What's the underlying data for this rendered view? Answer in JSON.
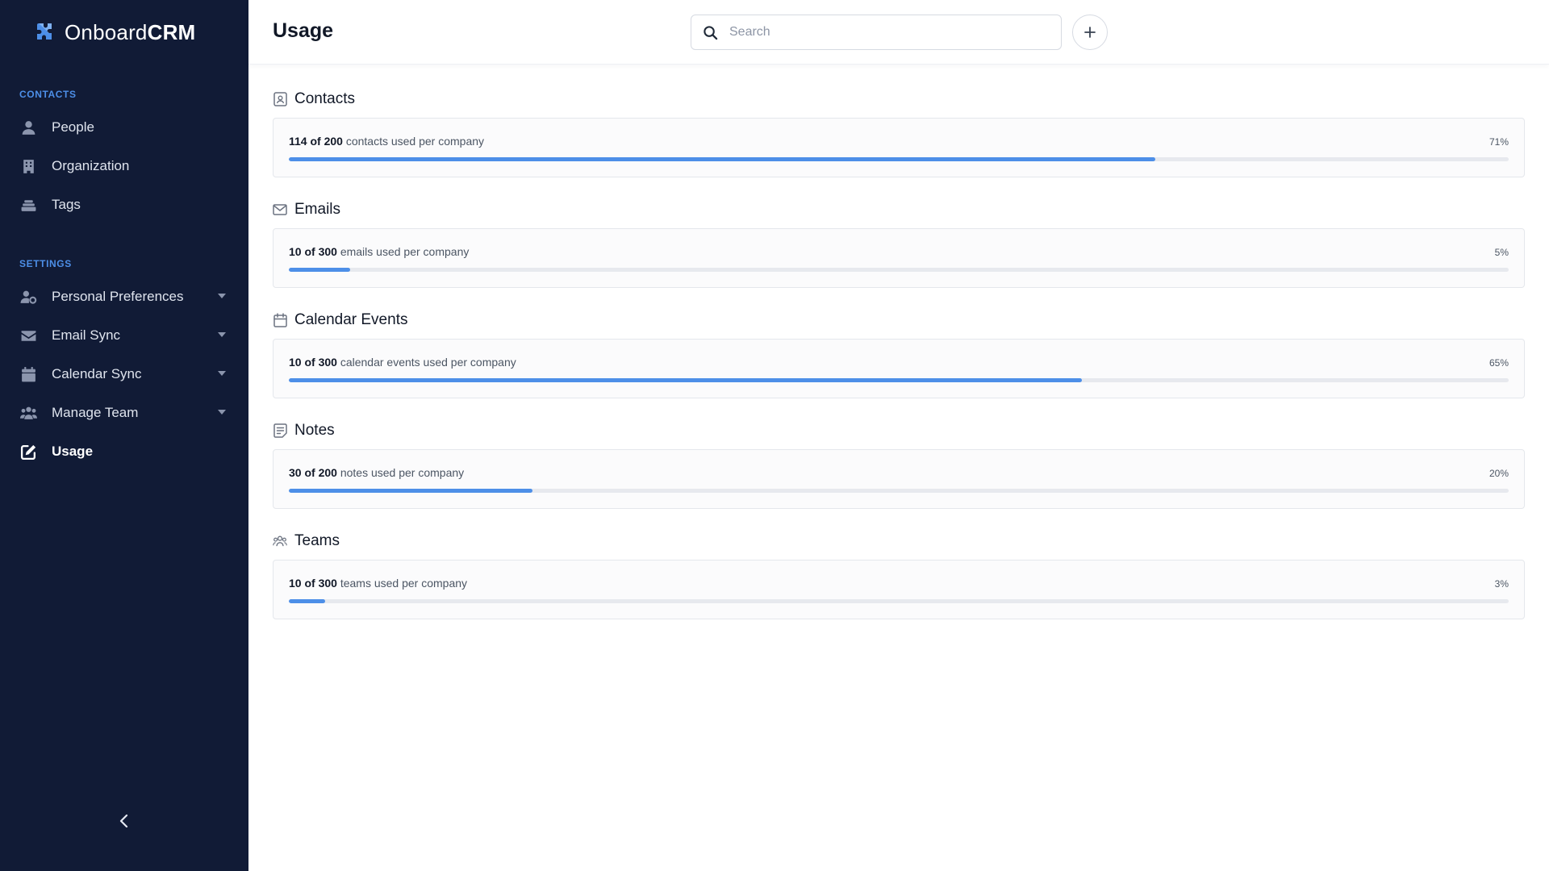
{
  "app": {
    "brand_light": "Onboard",
    "brand_bold": "CRM",
    "accent": "#4d8fe8",
    "sidebar_bg": "#111b36"
  },
  "sidebar": {
    "contacts_label": "CONTACTS",
    "settings_label": "SETTINGS",
    "contacts": [
      {
        "label": "People",
        "icon": "person-icon"
      },
      {
        "label": "Organization",
        "icon": "building-icon"
      },
      {
        "label": "Tags",
        "icon": "tags-icon"
      }
    ],
    "settings": [
      {
        "label": "Personal Preferences",
        "icon": "user-gear-icon",
        "expandable": true
      },
      {
        "label": "Email Sync",
        "icon": "envelope-icon",
        "expandable": true
      },
      {
        "label": "Calendar Sync",
        "icon": "calendar-icon",
        "expandable": true
      },
      {
        "label": "Manage Team",
        "icon": "team-icon",
        "expandable": true
      },
      {
        "label": "Usage",
        "icon": "edit-icon",
        "active": true
      }
    ]
  },
  "header": {
    "title": "Usage",
    "search_placeholder": "Search"
  },
  "usage": [
    {
      "title": "Contacts",
      "icon": "contact-card-icon",
      "used": "114 of 200",
      "suffix": " contacts used per company",
      "percent_label": "71%",
      "percent": 71
    },
    {
      "title": "Emails",
      "icon": "envelope-icon",
      "used": "10 of 300",
      "suffix": " emails used per company",
      "percent_label": "5%",
      "percent": 5
    },
    {
      "title": "Calendar Events",
      "icon": "calendar-icon",
      "used": "10 of 300",
      "suffix": " calendar events used per company",
      "percent_label": "65%",
      "percent": 65
    },
    {
      "title": "Notes",
      "icon": "note-icon",
      "used": "30 of 200",
      "suffix": " notes used per company",
      "percent_label": "20%",
      "percent": 20
    },
    {
      "title": "Teams",
      "icon": "team-icon",
      "used": "10 of 300",
      "suffix": " teams used per company",
      "percent_label": "3%",
      "percent": 3
    }
  ]
}
